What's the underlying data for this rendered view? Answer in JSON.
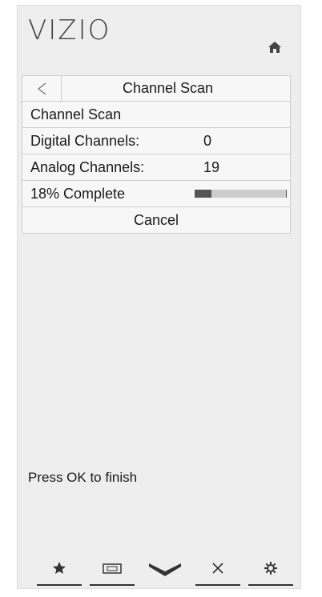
{
  "brand": "VIZIO",
  "menu": {
    "header_title": "Channel Scan",
    "rows": [
      {
        "label": "Channel Scan",
        "value": ""
      },
      {
        "label": "Digital Channels:",
        "value": "0"
      },
      {
        "label": "Analog Channels:",
        "value": "19"
      }
    ],
    "progress": {
      "label": "18% Complete",
      "percent": 18
    },
    "cancel_label": "Cancel"
  },
  "status_text": "Press OK to finish",
  "bottom_icons": [
    "star-icon",
    "wide-icon",
    "input-chevron-icon",
    "close-icon",
    "settings-gear-icon"
  ]
}
